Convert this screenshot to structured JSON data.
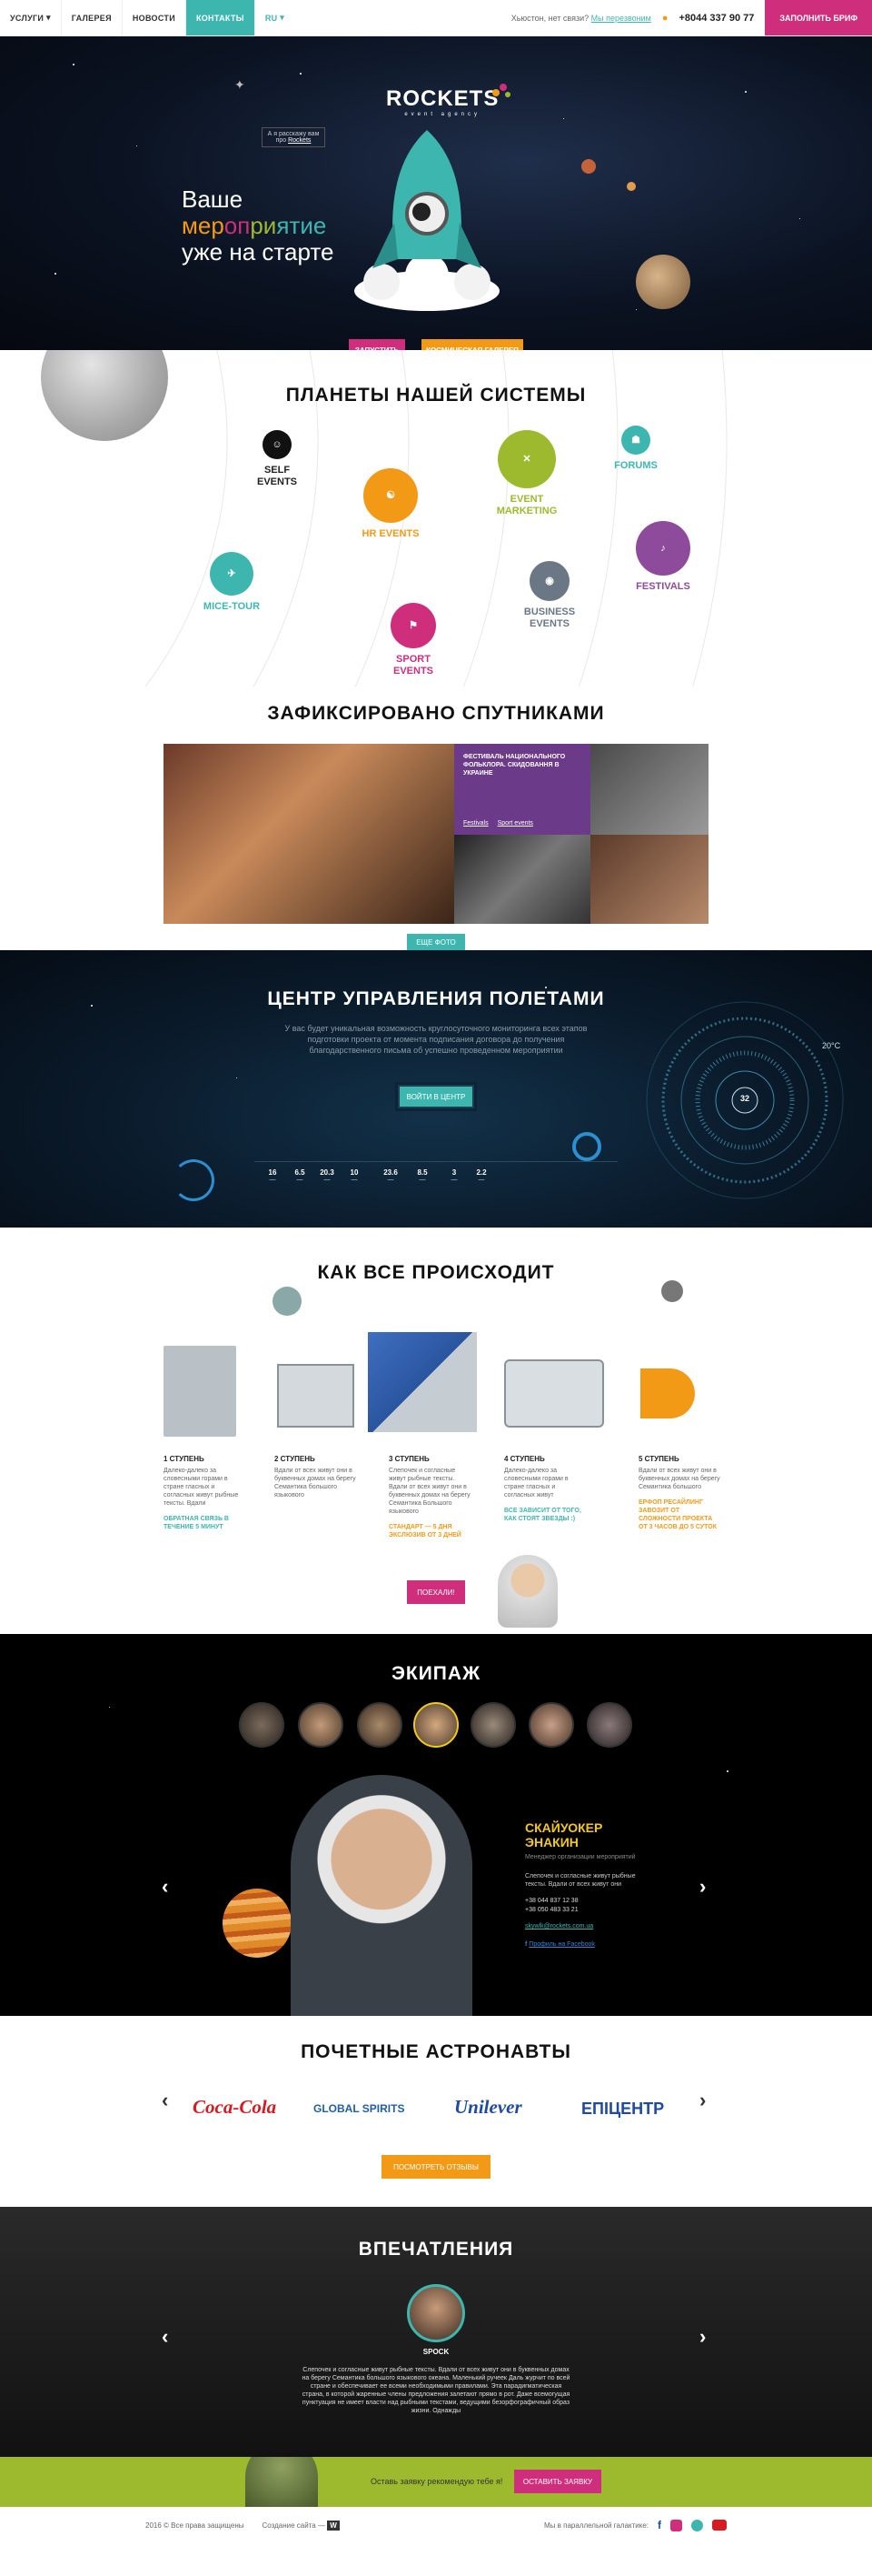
{
  "nav": {
    "items": [
      "Услуги",
      "Галерея",
      "Новости",
      "Контакты",
      "RU"
    ],
    "question": "Хьюстон, нет связи?",
    "question_link": "Мы перезвоним",
    "phone": "+8044 337 90 77",
    "brief_label": "Заполнить бриф"
  },
  "hero": {
    "logo": "ROCKETS",
    "logo_sub": "event agency",
    "tip_text": "А я расскажу вам про",
    "tip_link": "Rockets",
    "tagline_1": "Ваше",
    "tagline_2": [
      "мер",
      "оп",
      "ри",
      "ятие"
    ],
    "tagline_3": "уже на старте",
    "btn_launch": "Запустить",
    "btn_gallery": "Космическая галерея"
  },
  "planets": {
    "title": "Планеты нашей системы",
    "items": [
      {
        "label": "Self events",
        "color": "#111111",
        "icon": "self-events-icon"
      },
      {
        "label": "HR events",
        "color": "#f29a16",
        "icon": "hr-events-icon"
      },
      {
        "label": "Event marketing",
        "color": "#9dba2e",
        "icon": "event-marketing-icon"
      },
      {
        "label": "Forums",
        "color": "#3eb6b0",
        "icon": "forums-icon"
      },
      {
        "label": "Festivals",
        "color": "#8e4b9c",
        "icon": "festivals-icon"
      },
      {
        "label": "Business events",
        "color": "#6b7784",
        "icon": "business-events-icon"
      },
      {
        "label": "Sport events",
        "color": "#cf2e7d",
        "icon": "sport-events-icon"
      },
      {
        "label": "Mice-tour",
        "color": "#3eb6b0",
        "icon": "mice-tour-icon"
      }
    ]
  },
  "gallery": {
    "title": "Зафиксировано спутниками",
    "feature_title": "Фестиваль национального фольклора. Скидовання в Украине",
    "feature_tags": [
      "Festivals",
      "Sport events"
    ],
    "more_label": "Еще фото"
  },
  "control": {
    "title": "Центр управления полетами",
    "text": "У вас будет уникальная возможность круглосуточного мониторинга всех этапов подготовки проекта от момента подписания договора до получения благодарственного письма об успешно проведенном мероприятии",
    "button": "Войти в центр",
    "stats": [
      "16",
      "6.5",
      "20.3",
      "10",
      "23.6",
      "8.5",
      "3",
      "2.2"
    ],
    "gauge_value": "32",
    "temperature": "20°C"
  },
  "steps": {
    "title": "Как все происходит",
    "items": [
      {
        "title": "1 ступень",
        "text": "Далеко-далеко за словесными горами в стране гласных и согласных живут рыбные тексты. Вдали",
        "link": "Обратная связь в течение 5 минут",
        "link_color": "teal"
      },
      {
        "title": "2 ступень",
        "text": "Вдали от всех живут они в буквенных домах на берегу Семантика большого языкового",
        "link": "",
        "link_color": "teal"
      },
      {
        "title": "3 ступень",
        "text": "Слепочек и согласные живут рыбные тексты. Вдали от всех живут они в буквенных домах на берегу Семантика Большого языкового",
        "link": "Стандарт — 5 дня экслюзив от 3 дней",
        "link_color": "orange"
      },
      {
        "title": "4 ступень",
        "text": "Далеко-далеко за словесными горами в стране гласных и согласных живут",
        "link": "Все зависит от того, как стоят звезды :)",
        "link_color": "teal"
      },
      {
        "title": "5 ступень",
        "text": "Вдали от всех живут они в буквенных домах на берегу Семантика большого",
        "link": "Ерфоп ресайлинг завозит от сложности проекта от 3 часов до 5 суток",
        "link_color": "orange"
      }
    ],
    "button": "Поехали!"
  },
  "crew": {
    "title": "Экипаж",
    "name": "Скайуокер Энакин",
    "role": "Менеджер организации мероприятий",
    "bio": "Слепочек и согласные живут рыбные тексты. Вдали от всех живут они",
    "phone1": "+38 044 837 12 38",
    "phone2": "+38 050 483 33 21",
    "email": "skywlk@rockets.com.ua",
    "fb": "Профиль на Facebook"
  },
  "partners": {
    "title": "Почетные астронавты",
    "logos": [
      "Coca-Cola",
      "GLOBAL SPIRITS",
      "Unilever",
      "ЕПІЦЕНТР"
    ],
    "button": "Посмотреть отзывы"
  },
  "impress": {
    "title": "Впечатления",
    "name": "Spock",
    "quote": "Слепочек и согласные живут рыбные тексты. Вдали от всех живут они в буквенных домах на берегу Семантика большого языкового океана. Маленький ручеек Даль журчит по всей стране и обеспечивает ее всеми необходимыми правилами. Эта парадигматическая страна, в которой жаренные члены предложения залетают прямо в рот. Даже всемогущая пунктуация не имеет власти над рыбными текстами, ведущими безорфографичный образ жизни. Однажды"
  },
  "cta": {
    "text": "Оставь заявку рекомендую тебе я!",
    "button": "Оставить заявку"
  },
  "footer": {
    "copy": "2016 © Все права защищены",
    "made": "Создание сайта —",
    "made_brand": "W",
    "galaxy": "Мы в параллельной галактике:"
  }
}
